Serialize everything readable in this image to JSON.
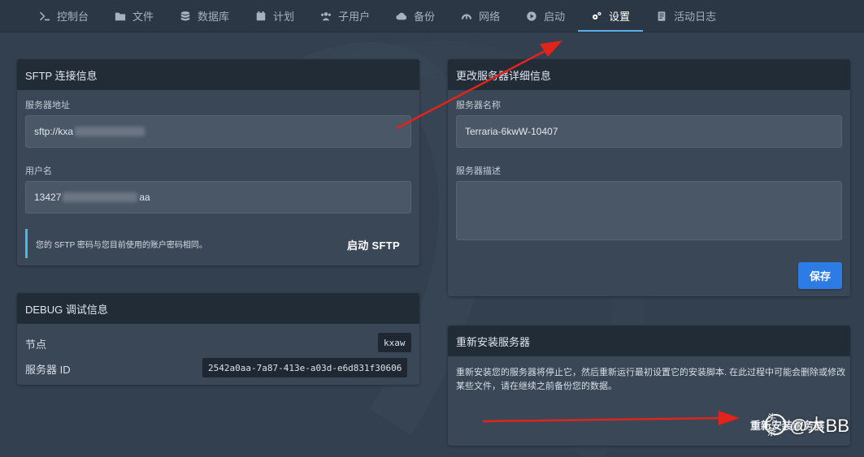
{
  "nav": {
    "items": [
      {
        "label": "控制台",
        "icon": "terminal-icon",
        "active": false
      },
      {
        "label": "文件",
        "icon": "folder-icon",
        "active": false
      },
      {
        "label": "数据库",
        "icon": "database-icon",
        "active": false
      },
      {
        "label": "计划",
        "icon": "calendar-icon",
        "active": false
      },
      {
        "label": "子用户",
        "icon": "users-icon",
        "active": false
      },
      {
        "label": "备份",
        "icon": "cloud-upload-icon",
        "active": false
      },
      {
        "label": "网络",
        "icon": "network-icon",
        "active": false
      },
      {
        "label": "启动",
        "icon": "play-icon",
        "active": false
      },
      {
        "label": "设置",
        "icon": "gears-icon",
        "active": true
      },
      {
        "label": "活动日志",
        "icon": "log-icon",
        "active": false
      }
    ]
  },
  "sftp": {
    "title": "SFTP 连接信息",
    "address_label": "服务器地址",
    "address_prefix": "sftp://kxa",
    "username_label": "用户名",
    "username_prefix": "13427",
    "username_suffix": "aa",
    "note": "您的 SFTP 密码与您目前使用的账户密码相同。",
    "launch_button": "启动 SFTP"
  },
  "debug": {
    "title": "DEBUG 调试信息",
    "node_label": "节点",
    "node_value": "kxaw",
    "server_id_label": "服务器 ID",
    "server_id_value": "2542a0aa-7a87-413e-a03d-e6d831f30606"
  },
  "details": {
    "title": "更改服务器详细信息",
    "name_label": "服务器名称",
    "name_value": "Terraria-6kwW-10407",
    "desc_label": "服务器描述",
    "desc_value": "",
    "save_button": "保存"
  },
  "reinstall": {
    "title": "重新安装服务器",
    "description": "重新安装您的服务器将停止它，然后重新运行最初设置它的安装脚本. 在此过程中可能会删除或修改某些文件，请在继续之前备份您的数据。",
    "button": "重新安装服务器"
  },
  "watermark": {
    "text": "@大BB",
    "logo": "头条"
  },
  "colors": {
    "background": "#33404f",
    "nav_bg": "#2b3744",
    "panel_bg": "#3a4756",
    "panel_head": "#222c37",
    "accent": "#5fb0e8",
    "primary_button": "#2d7be5",
    "annotation_arrow": "#e0241b"
  }
}
